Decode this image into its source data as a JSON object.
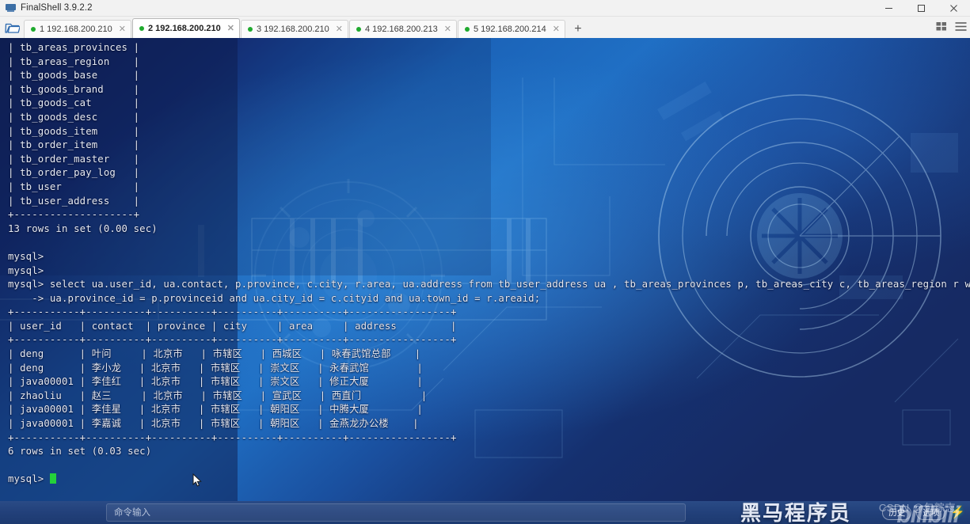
{
  "window": {
    "title": "FinalShell 3.9.2.2",
    "icon": "app-icon",
    "controls": {
      "minimize": "–",
      "maximize": "❐",
      "close": "✕"
    }
  },
  "tabbar": {
    "folder_icon": "open-folder-icon",
    "add_tab_label": "+",
    "layout_icon": "grid-layout-icon",
    "menu_icon": "hamburger-menu-icon",
    "tabs": [
      {
        "label": "1 192.168.200.210",
        "status": "connected",
        "close": "✕",
        "active": false
      },
      {
        "label": "2 192.168.200.210",
        "status": "connected",
        "close": "✕",
        "active": true
      },
      {
        "label": "3 192.168.200.210",
        "status": "connected",
        "close": "✕",
        "active": false
      },
      {
        "label": "4 192.168.200.213",
        "status": "connected",
        "close": "✕",
        "active": false
      },
      {
        "label": "5 192.168.200.214",
        "status": "connected",
        "close": "✕",
        "active": false
      }
    ]
  },
  "terminal": {
    "prompt": "mysql>",
    "continuation_prompt": "    ->",
    "tables_list": [
      "| tb_areas_provinces |",
      "| tb_areas_region    |",
      "| tb_goods_base      |",
      "| tb_goods_brand     |",
      "| tb_goods_cat       |",
      "| tb_goods_desc      |",
      "| tb_goods_item      |",
      "| tb_order_item      |",
      "| tb_order_master    |",
      "| tb_order_pay_log   |",
      "| tb_user            |",
      "| tb_user_address    |",
      "+--------------------+"
    ],
    "tables_result_line": "13 rows in set (0.00 sec)",
    "blank_prompts": [
      "mysql>",
      "mysql>"
    ],
    "query_line_1": "mysql> select ua.user_id, ua.contact, p.province, c.city, r.area, ua.address from tb_user_address ua , tb_areas_provinces p, tb_areas_city c, tb_areas_region r where",
    "query_line_2": "    -> ua.province_id = p.provinceid and ua.city_id = c.cityid and ua.town_id = r.areaid;",
    "result_divider": "+-----------+----------+-----------+-----------+-----------+-----------------+",
    "result_headers": [
      "user_id",
      "contact",
      "province",
      "city",
      "area",
      "address"
    ],
    "result_rows": [
      [
        "deng",
        "叶问",
        "北京市",
        "市辖区",
        "西城区",
        "咏春武馆总部"
      ],
      [
        "deng",
        "李小龙",
        "北京市",
        "市辖区",
        "崇文区",
        "永春武馆"
      ],
      [
        "java00001",
        "李佳红",
        "北京市",
        "市辖区",
        "崇文区",
        "修正大厦"
      ],
      [
        "zhaoliu",
        "赵三",
        "北京市",
        "市辖区",
        "宣武区",
        "西直门"
      ],
      [
        "java00001",
        "李佳星",
        "北京市",
        "市辖区",
        "朝阳区",
        "中腾大厦"
      ],
      [
        "java00001",
        "李嘉诚",
        "北京市",
        "市辖区",
        "朝阳区",
        "金燕龙办公楼"
      ]
    ],
    "rows_result_line": "6 rows in set (0.03 sec)",
    "final_prompt": "mysql>"
  },
  "bottombar": {
    "command_placeholder": "命令输入",
    "command_value": "",
    "history_button": "历史",
    "options_button": "选项",
    "bolt_icon": "lightning-bolt-icon"
  },
  "watermarks": {
    "brand": "黑马程序员",
    "csdn": "CSDN @包粽志",
    "bilibili": "bilibili"
  },
  "colors": {
    "titlebar_bg": "#f2f2f2",
    "tab_active_bg": "#ffffff",
    "status_dot": "#1faa2e",
    "terminal_text": "#e8ecf5",
    "cursor_green": "#24d13a",
    "bottombar_bg": "#22407a",
    "bolt_green": "#2ff04a"
  }
}
